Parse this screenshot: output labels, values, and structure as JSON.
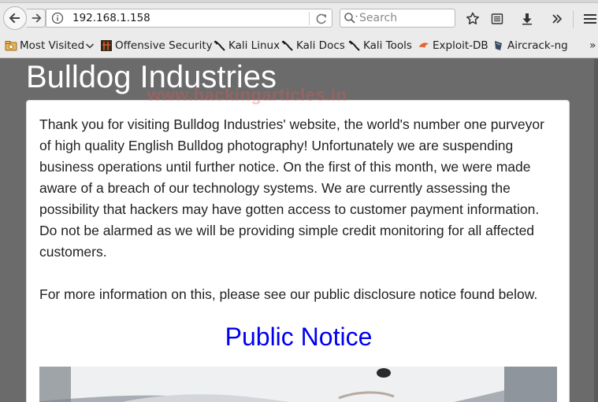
{
  "browser": {
    "url": "192.168.1.158",
    "search_placeholder": "Search",
    "toolbar_icons": [
      "back-icon",
      "forward-icon",
      "info-icon",
      "reload-icon",
      "search-icon",
      "bookmark-star-icon",
      "reader-list-icon",
      "download-icon",
      "overflow-chevrons-icon",
      "hamburger-menu-icon"
    ]
  },
  "bookmarks": {
    "items": [
      {
        "label": "Most Visited",
        "icon": "most-visited-icon"
      },
      {
        "label": "Offensive Security",
        "icon": "offsec-icon"
      },
      {
        "label": "Kali Linux",
        "icon": "kali-dragon-icon"
      },
      {
        "label": "Kali Docs",
        "icon": "kali-dragon-icon"
      },
      {
        "label": "Kali Tools",
        "icon": "kali-dragon-icon"
      },
      {
        "label": "Exploit-DB",
        "icon": "exploitdb-icon"
      },
      {
        "label": "Aircrack-ng",
        "icon": "aircrack-icon"
      }
    ],
    "overflow": "»"
  },
  "page": {
    "title": "Bulldog Industries",
    "intro": "Thank you for visiting Bulldog Industries' website, the world's number one purveyor of high quality English Bulldog photography! Unfortunately we are suspending business operations until further notice. On the first of this month, we were made aware of a breach of our technology systems. We are currently assessing the possibility that hackers may have gotten access to customer payment information. Do not be alarmed as we will be providing simple credit monitoring for all affected customers.",
    "more_info": "For more information on this, please see our public disclosure notice found below.",
    "notice_link": "Public Notice",
    "watermark": "www.hackingarticles.in"
  },
  "colors": {
    "page_background": "#6b6b6b",
    "link": "#0000ee",
    "title_text": "#ffffff"
  }
}
